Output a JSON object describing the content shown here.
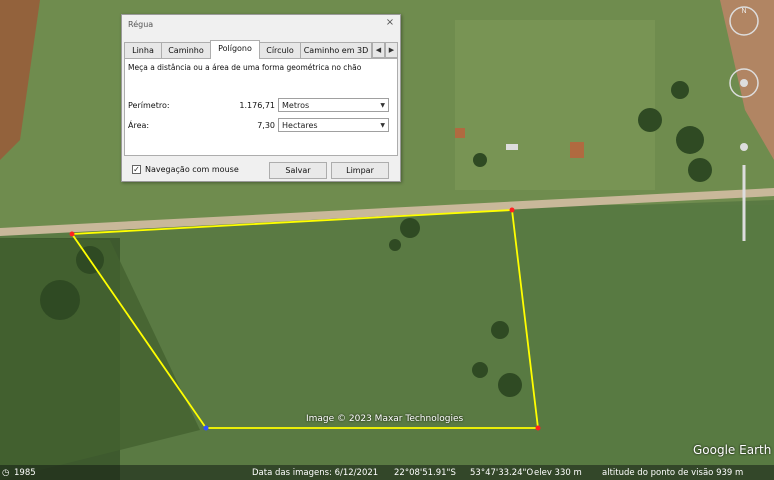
{
  "dialog": {
    "title": "Régua",
    "close": "×",
    "tabs": [
      "Linha",
      "Caminho",
      "Polígono",
      "Círculo",
      "Caminho em 3D"
    ],
    "active_tab": "Polígono",
    "description": "Meça a distância ou a área de uma forma geométrica no chão",
    "perimeter_label": "Perímetro:",
    "perimeter_value": "1.176,71",
    "perimeter_unit": "Metros",
    "area_label": "Área:",
    "area_value": "7,30",
    "area_unit": "Hectares",
    "mouse_nav_label": "Navegação com mouse",
    "mouse_nav_checked": true,
    "save_label": "Salvar",
    "clear_label": "Limpar"
  },
  "map": {
    "image_credit": "Image © 2023 Maxar Technologies",
    "brand": "Google Earth",
    "polygon_color": "#ffff00",
    "vertex_color": "#ff2020"
  },
  "statusbar": {
    "year": "1985",
    "image_date": "Data das imagens: 6/12/2021",
    "latitude": "22°08'51.91\"S",
    "longitude": "53°47'33.24\"O",
    "elev": "elev   330 m",
    "eye_alt": "altitude do ponto de visão   939 m"
  }
}
